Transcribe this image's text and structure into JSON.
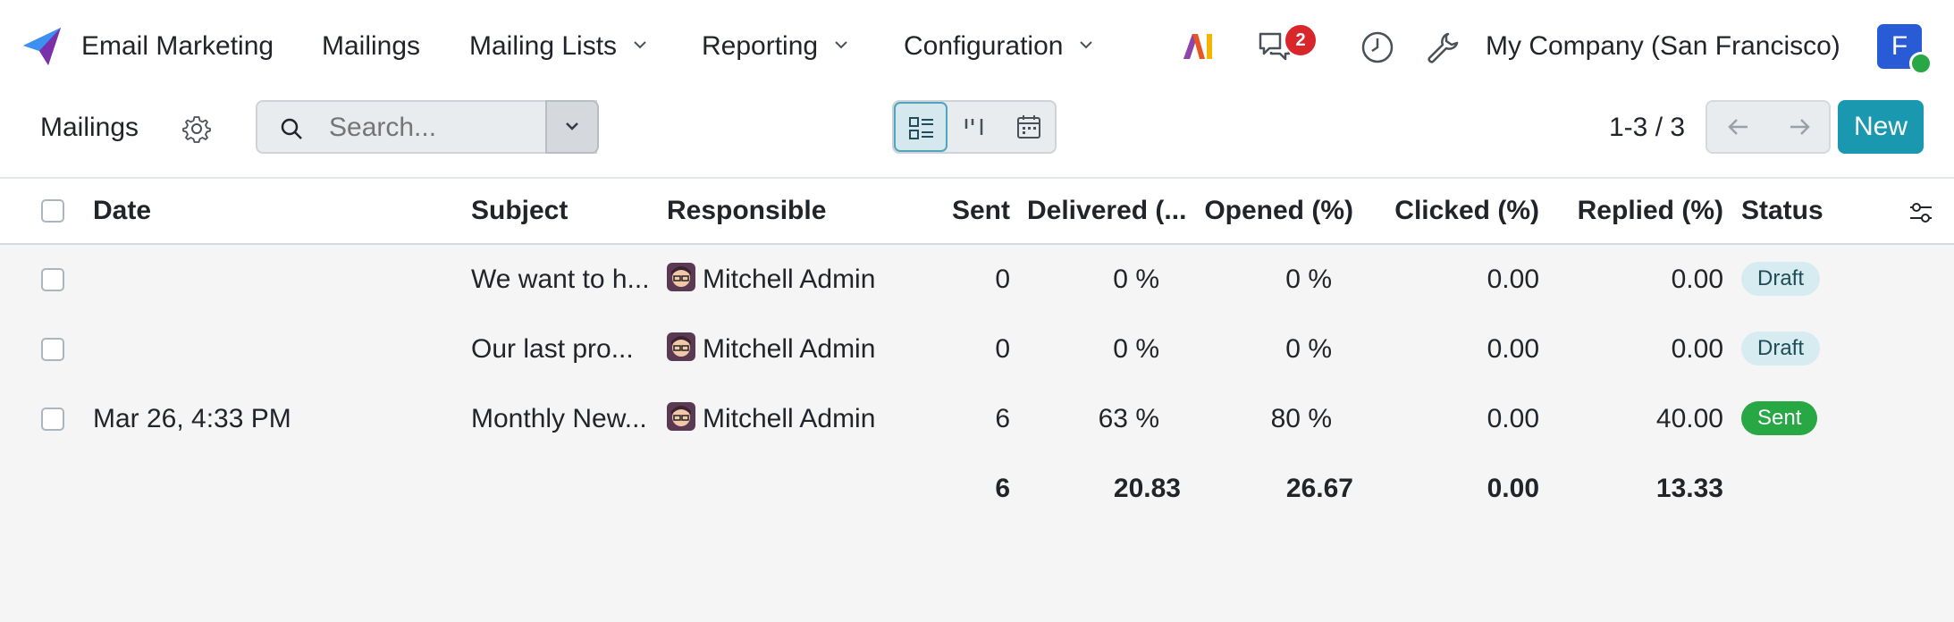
{
  "navbar": {
    "app_name": "Email Marketing",
    "menu": [
      {
        "label": "Mailings",
        "dropdown": false
      },
      {
        "label": "Mailing Lists",
        "dropdown": true
      },
      {
        "label": "Reporting",
        "dropdown": true
      },
      {
        "label": "Configuration",
        "dropdown": true
      }
    ],
    "ai_label": "AI",
    "messages_badge": "2",
    "company": "My Company (San Francisco)",
    "user_initial": "F"
  },
  "control_panel": {
    "breadcrumb": "Mailings",
    "search_placeholder": "Search...",
    "pager": "1-3 / 3",
    "new_label": "New"
  },
  "table": {
    "columns": [
      "Date",
      "Subject",
      "Responsible",
      "Sent",
      "Delivered (...",
      "Opened (%)",
      "Clicked (%)",
      "Replied (%)",
      "Status"
    ],
    "rows": [
      {
        "date": "",
        "subject": "We want to h...",
        "responsible": "Mitchell Admin",
        "sent": "0",
        "delivered": "0 %",
        "opened": "0 %",
        "clicked": "0.00",
        "replied": "0.00",
        "status": "Draft",
        "status_kind": "draft"
      },
      {
        "date": "",
        "subject": "Our last pro...",
        "responsible": "Mitchell Admin",
        "sent": "0",
        "delivered": "0 %",
        "opened": "0 %",
        "clicked": "0.00",
        "replied": "0.00",
        "status": "Draft",
        "status_kind": "draft"
      },
      {
        "date": "Mar 26, 4:33 PM",
        "subject": "Monthly New...",
        "responsible": "Mitchell Admin",
        "sent": "6",
        "delivered": "63 %",
        "opened": "80 %",
        "clicked": "0.00",
        "replied": "40.00",
        "status": "Sent",
        "status_kind": "sent"
      }
    ],
    "totals": {
      "sent": "6",
      "delivered": "20.83",
      "opened": "26.67",
      "clicked": "0.00",
      "replied": "13.33"
    }
  },
  "colors": {
    "primary": "#1a98b0",
    "badge": "#d9262b",
    "sent_status": "#28a745",
    "draft_status": "#d6ecf0"
  }
}
